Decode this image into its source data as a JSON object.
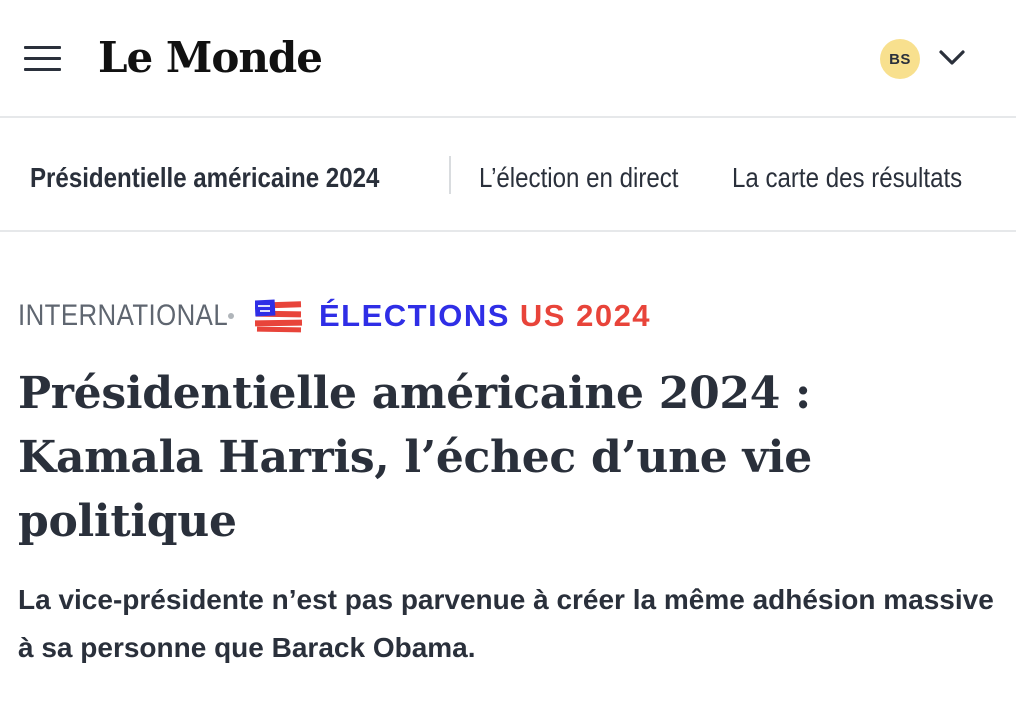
{
  "header": {
    "logo_text": "Le Monde",
    "avatar_initials": "BS",
    "icons": [
      "hamburger-menu-icon",
      "chevron-down-icon"
    ]
  },
  "subnav": {
    "items": [
      {
        "label": "Présidentielle américaine 2024"
      },
      {
        "label": "L’élection en direct"
      },
      {
        "label": "La carte des résultats"
      }
    ]
  },
  "kicker": {
    "section": "INTERNATIONAL",
    "tag_part1": "ÉLECTIONS",
    "tag_part2": "US 2024",
    "tag_icon": "us-flag-icon"
  },
  "article": {
    "headline": "Présidentielle américaine 2024 : Kamala Harris, l’échec d’une vie politique",
    "standfirst": "La vice-présidente n’est pas parvenue à créer la même adhésion massive à sa personne que Barack Obama."
  },
  "colors": {
    "text": "#2a303b",
    "muted": "#5f6670",
    "avatar_bg": "#f8e08e",
    "blue": "#2f2ee6",
    "red": "#e8443a",
    "divider": "#e6e8ea"
  }
}
